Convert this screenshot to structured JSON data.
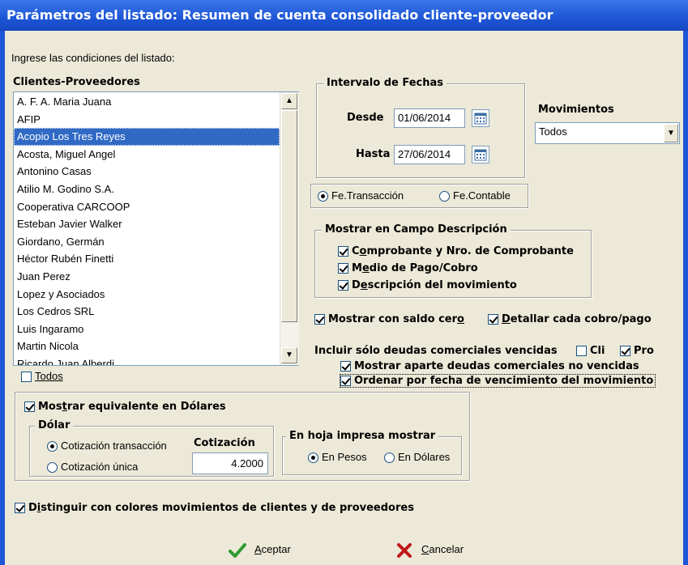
{
  "window": {
    "title": "Parámetros del listado: Resumen de cuenta consolidado cliente-proveedor"
  },
  "instructions": "Ingrese las condiciones del listado:",
  "clients": {
    "label": "Clientes-Proveedores",
    "items": [
      "A. F. A. Maria Juana",
      "AFIP",
      "Acopio Los Tres Reyes",
      "Acosta, Miguel Angel",
      "Antonino Casas",
      "Atilio M. Godino S.A.",
      "Cooperativa CARCOOP",
      "Esteban Javier Walker",
      "Giordano, Germán",
      "Héctor Rubén Finetti",
      "Juan Perez",
      "Lopez y Asociados",
      "Los Cedros SRL",
      "Luis Ingaramo",
      "Martin Nicola",
      "Ricardo Juan Alberdi"
    ],
    "selected": "Acopio Los Tres Reyes",
    "todos_label": "Todos"
  },
  "fechas": {
    "group_label": "Intervalo de Fechas",
    "desde_label": "Desde",
    "desde_value": "01/06/2014",
    "hasta_label": "Hasta",
    "hasta_value": "27/06/2014"
  },
  "movimientos": {
    "label": "Movimientos",
    "value": "Todos"
  },
  "fecha_tipo": {
    "transaccion": "Fe.Transacción",
    "contable": "Fe.Contable",
    "selected": "transaccion"
  },
  "descripcion": {
    "group_label": "Mostrar en Campo Descripción",
    "comprobante_pre": "C",
    "comprobante_u": "o",
    "comprobante_post": "mprobante y Nro. de Comprobante",
    "medio_pre": "M",
    "medio_u": "e",
    "medio_post": "dio de Pago/Cobro",
    "desc_pre": "D",
    "desc_u": "e",
    "desc_post": "scripción del movimiento"
  },
  "opciones": {
    "saldo_cero_pre": "Mostrar con saldo cer",
    "saldo_cero_u": "o",
    "detallar_u": "D",
    "detallar_post": "etallar cada cobro/pago",
    "vencidas_label": "Incluir sólo deudas comerciales vencidas",
    "cli_label": "Cli",
    "pro_label": "Pro",
    "aparte_label": "Mostrar aparte deudas comerciales no vencidas",
    "ordenar_label": "Ordenar por fecha de vencimiento del movimiento"
  },
  "dolares": {
    "check_pre": "Mos",
    "check_u": "t",
    "check_post": "rar equivalente en Dólares",
    "dolar_label": "Dólar",
    "cot_transaccion": "Cotización transacción",
    "cot_unica": "Cotización única",
    "cotizacion_label": "Cotización",
    "cotizacion_value": "4.2000",
    "hoja_label": "En hoja impresa mostrar",
    "pesos": "En Pesos",
    "dolares_opt": "En Dólares"
  },
  "distinguir": {
    "pre": "D",
    "u": "i",
    "post": "stinguir con colores movimientos de clientes y de proveedores"
  },
  "buttons": {
    "aceptar_u": "A",
    "aceptar_post": "ceptar",
    "cancelar_u": "C",
    "cancelar_post": "ancelar"
  },
  "colors": {
    "titlebar": "#1D56D6",
    "selection": "#316AC5",
    "face": "#ECE9D8"
  }
}
